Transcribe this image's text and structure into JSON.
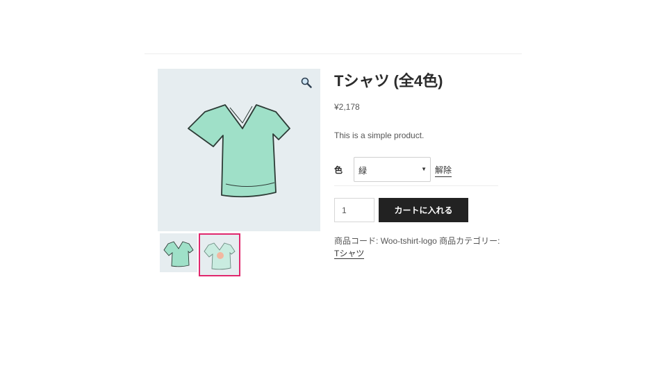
{
  "product": {
    "title": "Tシャツ (全4色)",
    "price": "¥2,178",
    "description": "This is a simple product."
  },
  "variation": {
    "label": "色",
    "selected": "緑",
    "reset_label": "解除"
  },
  "cart": {
    "quantity": "1",
    "button_label": "カートに入れる"
  },
  "meta": {
    "sku_label": "商品コード:",
    "sku_value": "Woo-tshirt-logo",
    "category_label": "商品カテゴリー:",
    "category_value": "Tシャツ"
  },
  "gallery": {
    "thumbnails": [
      {
        "name": "tshirt-plain",
        "selected": false
      },
      {
        "name": "tshirt-logo",
        "selected": true
      }
    ],
    "zoom_icon": "magnifier-icon"
  },
  "colors": {
    "accent": "#e0276d",
    "button_bg": "#222222",
    "shirt": "#9fe0c8"
  }
}
